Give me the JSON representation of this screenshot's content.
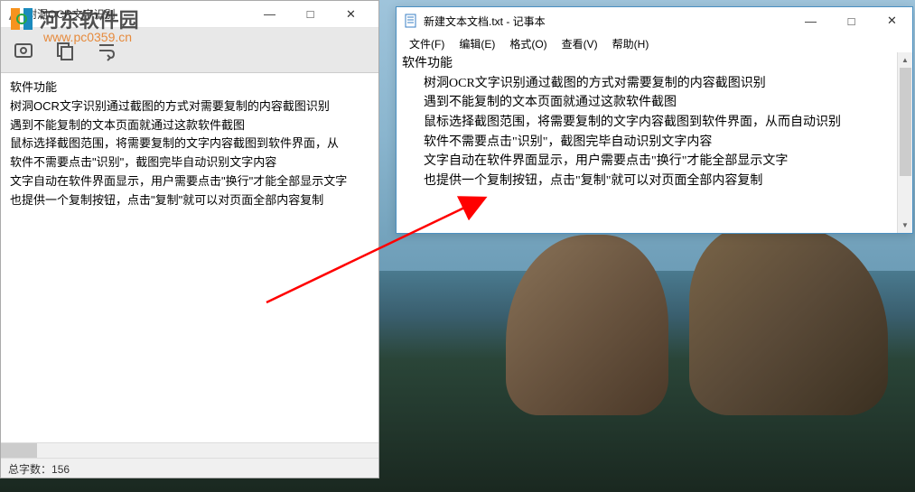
{
  "watermark": {
    "text": "河东软件园",
    "url": "www.pc0359.cn"
  },
  "ocr_window": {
    "title": "树洞OCR文字识别",
    "body": {
      "heading": "软件功能",
      "lines": [
        "树洞OCR文字识别通过截图的方式对需要复制的内容截图识别",
        "遇到不能复制的文本页面就通过这款软件截图",
        "鼠标选择截图范围，将需要复制的文字内容截图到软件界面，从",
        "软件不需要点击\"识别\"，截图完毕自动识别文字内容",
        "文字自动在软件界面显示，用户需要点击\"换行\"才能全部显示文字",
        "也提供一个复制按钮，点击\"复制\"就可以对页面全部内容复制"
      ]
    },
    "status_label": "总字数：",
    "status_count": "156"
  },
  "notepad_window": {
    "title": "新建文本文档.txt - 记事本",
    "menu": {
      "file": "文件(F)",
      "edit": "编辑(E)",
      "format": "格式(O)",
      "view": "查看(V)",
      "help": "帮助(H)"
    },
    "body": {
      "heading": "软件功能",
      "lines": [
        "树洞OCR文字识别通过截图的方式对需要复制的内容截图识别",
        "遇到不能复制的文本页面就通过这款软件截图",
        "鼠标选择截图范围，将需要复制的文字内容截图到软件界面，从而自动识别",
        "软件不需要点击\"识别\"，截图完毕自动识别文字内容",
        "文字自动在软件界面显示，用户需要点击\"换行\"才能全部显示文字",
        "也提供一个复制按钮，点击\"复制\"就可以对页面全部内容复制"
      ]
    }
  },
  "win_controls": {
    "minimize": "—",
    "maximize": "□",
    "close": "✕"
  }
}
